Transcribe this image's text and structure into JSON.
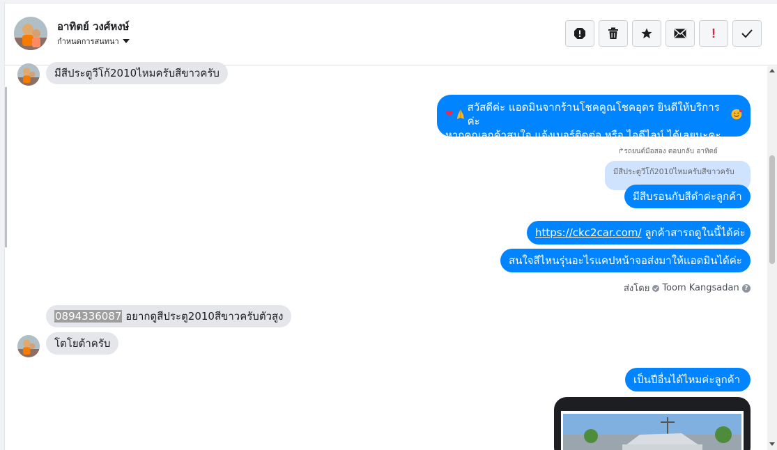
{
  "header": {
    "name": "อาทิตย์ วงศ์หงษ์",
    "assign_label": "กำหนดการสนทนา",
    "tools": [
      {
        "name": "spam-icon",
        "glyph": "!"
      },
      {
        "name": "trash-icon",
        "glyph": ""
      },
      {
        "name": "star-icon",
        "glyph": "★"
      },
      {
        "name": "mail-icon",
        "glyph": "✉"
      },
      {
        "name": "important-icon",
        "glyph": "!"
      },
      {
        "name": "checkmark-icon",
        "glyph": "✓"
      }
    ]
  },
  "messages": {
    "m1": "มีสีประตูวีโก้2010ไหมครับสีขาวครับ",
    "m2_line1": "สวัสดีค่ะ แอดมินจากร้านโชคคูณโชคอุดร ยินดีให้บริการค่ะ",
    "m2_line2": "หากคุณลูกค้าสนใจ แจ้งเบอร์ติดต่อ หรือ ไอดีไลน์ ได้เลยนะคะ",
    "reply_meta": "รถยนต์มือสอง ตอบกลับ อาทิตย์",
    "quoted": "มีสีประตูวีโก้2010ไหมครับสีขาวครับ",
    "m3": "มีสีบรอนกับสีดำค่ะลูกค้า",
    "m4_link": "https://ckc2car.com/",
    "m4_rest": " ลูกค้าสารถดูในนี้ได้ค่ะ",
    "m5": "สนใจสีไหนรุ่นอะไรแคปหน้าจอส่งมาให้แอดมินได้ค่ะ",
    "sent_by_label": "ส่งโดย",
    "sent_by_name": "Toom Kangsadan",
    "m6_phone": "0894336087",
    "m6_rest": " อยากดูสีประตู2010สีขาวครับตัวสูง",
    "m7": "โตโยต้าครับ",
    "m8": "เป็นปีอื่นได้ไหมค่ะลูกค้า"
  },
  "colors": {
    "outgoing": "#0084ff",
    "incoming": "#e4e6eb",
    "quote": "#cfe3ff"
  }
}
